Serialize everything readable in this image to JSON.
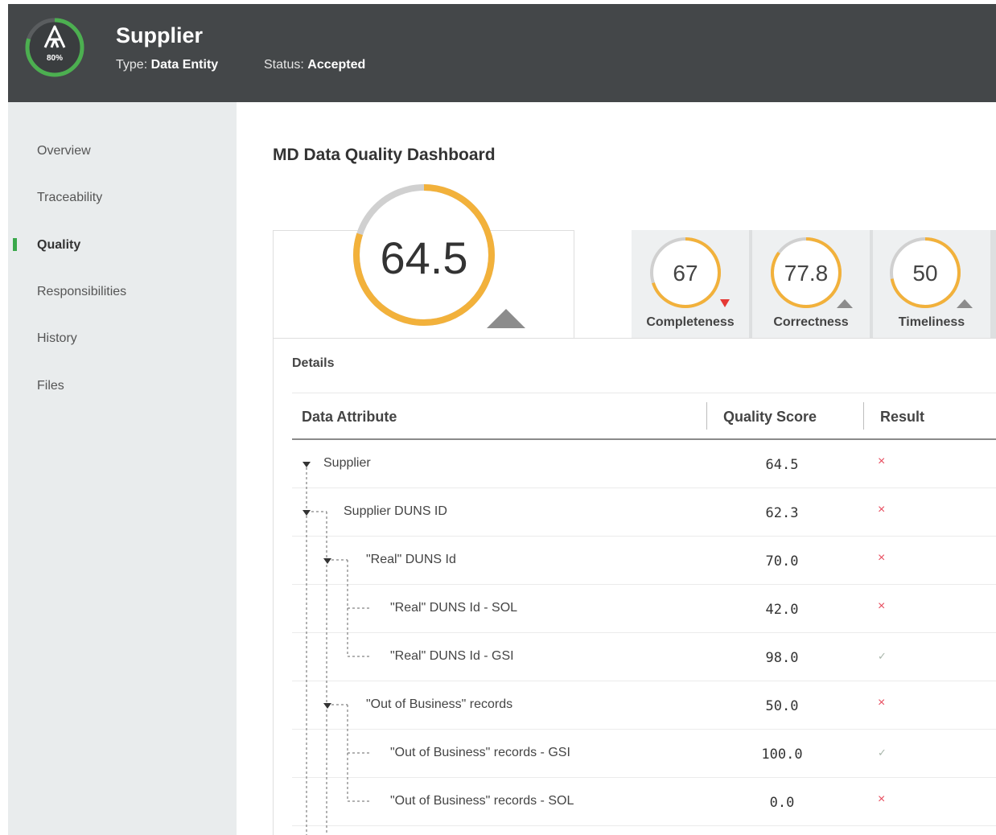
{
  "header": {
    "logo_percent": "80%",
    "title": "Supplier",
    "type_label": "Type:",
    "type_value": "Data Entity",
    "status_label": "Status:",
    "status_value": "Accepted",
    "logo_progress": 0.8,
    "accent_color": "#4caf50"
  },
  "sidebar": {
    "items": [
      {
        "label": "Overview"
      },
      {
        "label": "Traceability"
      },
      {
        "label": "Quality",
        "active": true
      },
      {
        "label": "Responsibilities"
      },
      {
        "label": "History"
      },
      {
        "label": "Files"
      }
    ],
    "active_color": "#3aa84b"
  },
  "dashboard": {
    "title": "MD Data Quality Dashboard",
    "overall_score": "64.5",
    "overall_ring_fraction": 0.8,
    "overall_trend": "up",
    "ring_color": "#f2b13b",
    "metrics": [
      {
        "value": "67",
        "label": "Completeness",
        "trend": "down",
        "trend_color": "#e53935",
        "ring_fraction": 0.7
      },
      {
        "value": "77.8",
        "label": "Correctness",
        "trend": "up",
        "trend_color": "#8c8c8c",
        "ring_fraction": 0.85
      },
      {
        "value": "50",
        "label": "Timeliness",
        "trend": "up",
        "trend_color": "#8c8c8c",
        "ring_fraction": 0.72
      }
    ]
  },
  "details": {
    "label": "Details",
    "columns": {
      "attribute": "Data Attribute",
      "score": "Quality Score",
      "result": "Result"
    },
    "rows": [
      {
        "name": "Supplier",
        "score": "64.5",
        "result": "fail",
        "symbol": "×"
      },
      {
        "name": "Supplier DUNS ID",
        "score": "62.3",
        "result": "fail",
        "symbol": "×"
      },
      {
        "name": "\"Real\" DUNS Id",
        "score": "70.0",
        "result": "fail",
        "symbol": "×"
      },
      {
        "name": "\"Real\" DUNS Id - SOL",
        "score": "42.0",
        "result": "fail",
        "symbol": "×"
      },
      {
        "name": "\"Real\" DUNS Id - GSI",
        "score": "98.0",
        "result": "pass",
        "symbol": "✓"
      },
      {
        "name": "\"Out of Business\" records",
        "score": "50.0",
        "result": "fail",
        "symbol": "×"
      },
      {
        "name": "\"Out of Business\" records - GSI",
        "score": "100.0",
        "result": "pass",
        "symbol": "✓"
      },
      {
        "name": "\"Out of Business\" records - SOL",
        "score": "0.0",
        "result": "fail",
        "symbol": "×"
      }
    ]
  }
}
